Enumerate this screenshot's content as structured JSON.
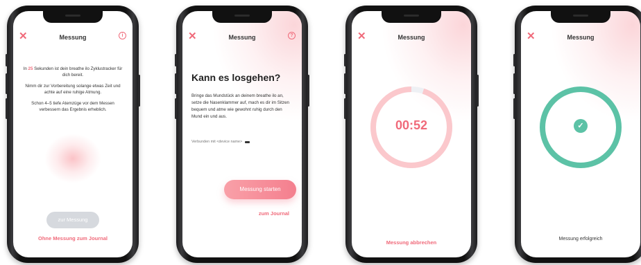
{
  "screens": [
    {
      "title": "Messung",
      "intro_prefix": "In ",
      "seconds": "25",
      "intro_suffix": " Sekunden ist dein breathe ilo Zyklustracker für dich bereit.",
      "paragraph2": "Nimm dir zur Vorbereitung solange etwas Zeit und achte auf eine ruhige Atmung.",
      "paragraph3": "Schon 4–5 tiefe Atemzüge vor dem Messen verbessern das Ergebnis erheblich.",
      "button_label": "zur Messung",
      "link_label": "Ohne Messung zum Journal"
    },
    {
      "title": "Messung",
      "heading": "Kann es losgehen?",
      "body": "Bringe das Mundstück an deinem breathe ilo an, setze die Nasenklammer auf, mach es dir im Sitzen bequem und atme wie gewohnt ruhig durch den Mund ein und aus.",
      "connection": "Verbunden mit <device name>",
      "button_label": "Messung starten",
      "link_label": "zum Journal"
    },
    {
      "title": "Messung",
      "timer": "00:52",
      "progress": 0.95,
      "link_label": "Messung abbrechen"
    },
    {
      "title": "Messung",
      "status": "Messung erfolgreich"
    }
  ],
  "colors": {
    "accent": "#f06a7a",
    "ring_pink": "#fbc8cc",
    "ring_track": "#eef0f4",
    "success": "#5cc2a6",
    "disabled_button": "#d6d9de"
  },
  "icons": {
    "close": "close-icon",
    "info": "info-icon",
    "check": "checkmark-icon",
    "battery": "battery-icon"
  }
}
